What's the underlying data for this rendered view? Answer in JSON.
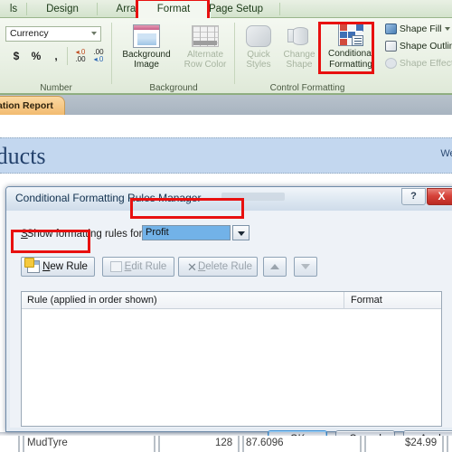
{
  "ribbon": {
    "tabs": [
      {
        "label": "ls",
        "active": false
      },
      {
        "label": "Design",
        "active": false
      },
      {
        "label": "Arrange",
        "active": false
      },
      {
        "label": "Format",
        "active": true
      },
      {
        "label": "Page Setup",
        "active": false
      }
    ],
    "groups": {
      "number": {
        "label": "Number",
        "format_value": "Currency",
        "buttons": [
          "$",
          "%",
          ",",
          "+.0 .00",
          ".00 +.0"
        ]
      },
      "background": {
        "label": "Background",
        "background_image": "Background Image",
        "alternate_row_color": "Alternate Row Color"
      },
      "control_formatting": {
        "label": "Control Formatting",
        "quick_styles": "Quick Styles",
        "change_shape": "Change Shape",
        "conditional_formatting": "Conditional Formatting",
        "shape_fill": "Shape Fill",
        "shape_outline": "Shape Outline",
        "shape_effects": "Shape Effects"
      }
    },
    "highlight_color": "#e8100f"
  },
  "document": {
    "tab_label": "ation Report",
    "report_title": "roducts",
    "report_date": "Wedne"
  },
  "dialog": {
    "title": "Conditional Formatting Rules Manager",
    "help_label": "?",
    "close_label": "X",
    "show_rules_label": "Show formatting rules for:",
    "show_rules_value": "Profit",
    "toolbar": {
      "new_rule": "New Rule",
      "edit_rule": "Edit Rule",
      "delete_rule": "Delete Rule",
      "move_up": "move-up",
      "move_down": "move-down"
    },
    "list": {
      "col_rule": "Rule (applied in order shown)",
      "col_format": "Format",
      "rows": []
    },
    "footer": {
      "ok": "OK",
      "cancel": "Cancel",
      "apply": "Apply"
    }
  },
  "data_row": {
    "name": "MudTyre",
    "qty": "128",
    "value": "87.6096",
    "price": "$24.99"
  }
}
